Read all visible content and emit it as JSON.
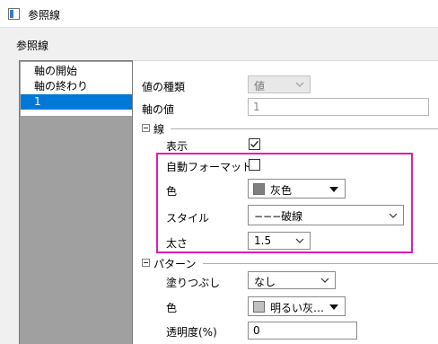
{
  "window": {
    "title": "参照線"
  },
  "section_label": "参照線",
  "tree": {
    "items": [
      {
        "label": "軸の開始",
        "selected": false
      },
      {
        "label": "軸の終わり",
        "selected": false
      },
      {
        "label": "1",
        "selected": true
      }
    ]
  },
  "fields": {
    "value_type": {
      "label": "値の種類",
      "value": "値"
    },
    "axis_value": {
      "label": "軸の値",
      "value": "1"
    }
  },
  "line_group": {
    "title": "線",
    "show": {
      "label": "表示",
      "checked": true
    },
    "auto_format": {
      "label": "自動フォーマット",
      "checked": false
    },
    "color": {
      "label": "色",
      "value": "灰色",
      "swatch": "#7f7f7f"
    },
    "style": {
      "label": "スタイル",
      "value": "−−−破線"
    },
    "width": {
      "label": "太さ",
      "value": "1.5"
    }
  },
  "pattern_group": {
    "title": "パターン",
    "fill": {
      "label": "塗りつぶし",
      "value": "なし"
    },
    "color": {
      "label": "色",
      "value": "明るい灰…",
      "swatch": "#c0c0c0"
    },
    "transparency": {
      "label": "透明度(%)",
      "value": "0"
    }
  },
  "colors": {
    "highlight": "#e01cb8",
    "selection": "#0078d7"
  }
}
